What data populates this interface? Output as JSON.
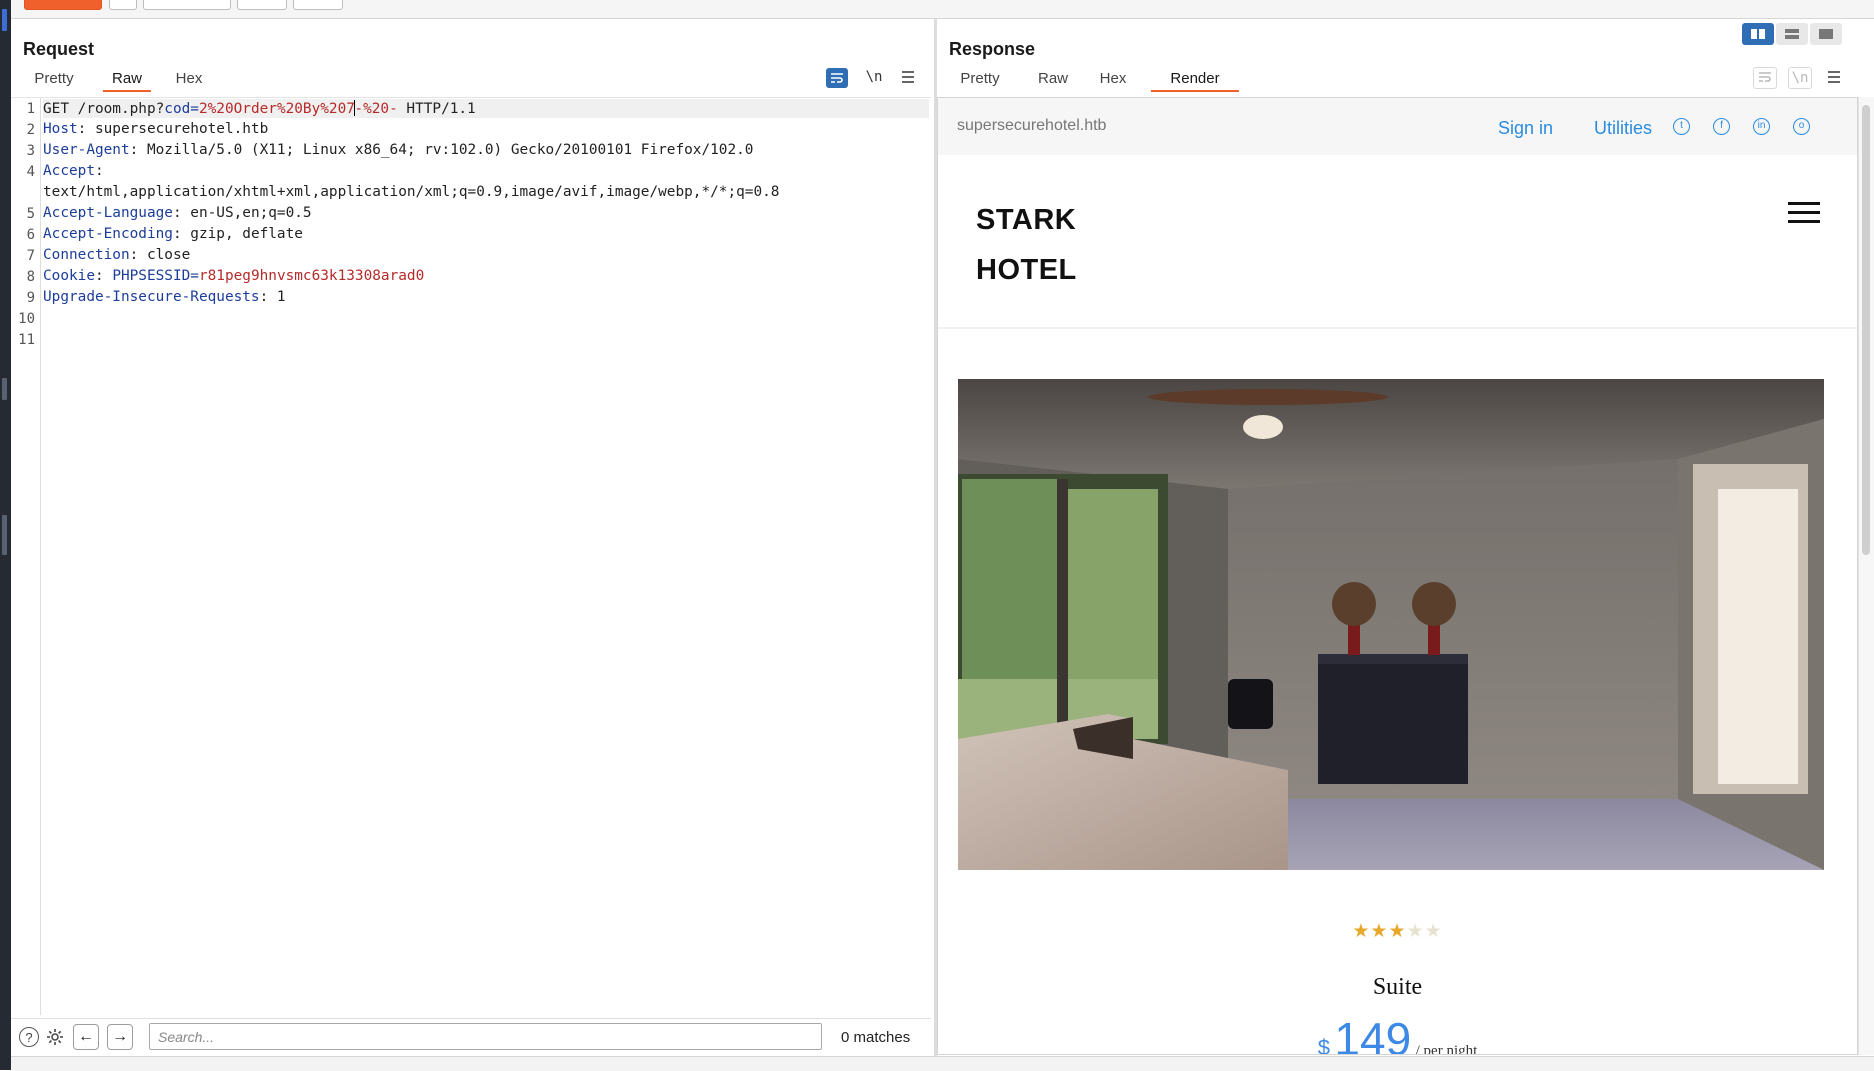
{
  "request": {
    "title": "Request",
    "tabs": [
      "Pretty",
      "Raw",
      "Hex"
    ],
    "active_tab": "Raw",
    "tools": {
      "wrap_icon": "wrap-lines-icon",
      "newline_label": "\\n",
      "menu_icon": "hamburger-menu-icon"
    },
    "line_numbers": [
      "1",
      "2",
      "3",
      "4",
      "",
      "5",
      "6",
      "7",
      "8",
      "9",
      "10",
      "11"
    ],
    "lines": {
      "l1_a": "GET /room.php?",
      "l1_param": "cod",
      "l1_eq": "=",
      "l1_val_a": "2%20Order%20By%207",
      "l1_val_b": "-%20-",
      "l1_tail": " HTTP/1.1",
      "l2_key": "Host",
      "l2_val": ": supersecurehotel.htb",
      "l3_key": "User-Agent",
      "l3_val": ": Mozilla/5.0 (X11; Linux x86_64; rv:102.0) Gecko/20100101 Firefox/102.0",
      "l4_key": "Accept",
      "l4_val": ":",
      "l4_cont": "text/html,application/xhtml+xml,application/xml;q=0.9,image/avif,image/webp,*/*;q=0.8",
      "l5_key": "Accept-Language",
      "l5_val": ": en-US,en;q=0.5",
      "l6_key": "Accept-Encoding",
      "l6_val": ": gzip, deflate",
      "l7_key": "Connection",
      "l7_val": ": close",
      "l8_key": "Cookie",
      "l8_sep": ": ",
      "l8_cname": "PHPSESSID",
      "l8_eq": "=",
      "l8_cval": "r81peg9hnvsmc63k13308arad0",
      "l9_key": "Upgrade-Insecure-Requests",
      "l9_val": ": 1"
    },
    "search": {
      "placeholder": "Search...",
      "value": "",
      "matches": "0 matches"
    },
    "footer_icons": [
      "help-icon",
      "settings-icon",
      "back-arrow-icon",
      "forward-arrow-icon"
    ]
  },
  "response": {
    "title": "Response",
    "tabs": [
      "Pretty",
      "Raw",
      "Hex",
      "Render"
    ],
    "active_tab": "Render",
    "tools": {
      "wrap_icon": "wrap-lines-icon",
      "newline_label": "\\n",
      "menu_icon": "hamburger-menu-icon"
    },
    "layout_toggle": [
      "split-horizontal-icon",
      "split-vertical-icon",
      "single-pane-icon"
    ],
    "render": {
      "domain": "supersecurehotel.htb",
      "sign_in": "Sign in",
      "utilities": "Utilities",
      "social_icons": [
        "twitter-icon",
        "facebook-icon",
        "linkedin-icon",
        "instagram-icon"
      ],
      "brand_line1": "STARK",
      "brand_line2": "HOTEL",
      "rating": 3,
      "rating_max": 5,
      "room_name": "Suite",
      "price_currency": "$",
      "price_value": "149",
      "price_unit": "/ per night"
    }
  },
  "colors": {
    "accent": "#f0602c",
    "toggle_active": "#2f6db5",
    "header_key": "#1d3d9b",
    "param_value": "#b62a2a",
    "link": "#2a8be0",
    "star": "#e7a82b"
  }
}
